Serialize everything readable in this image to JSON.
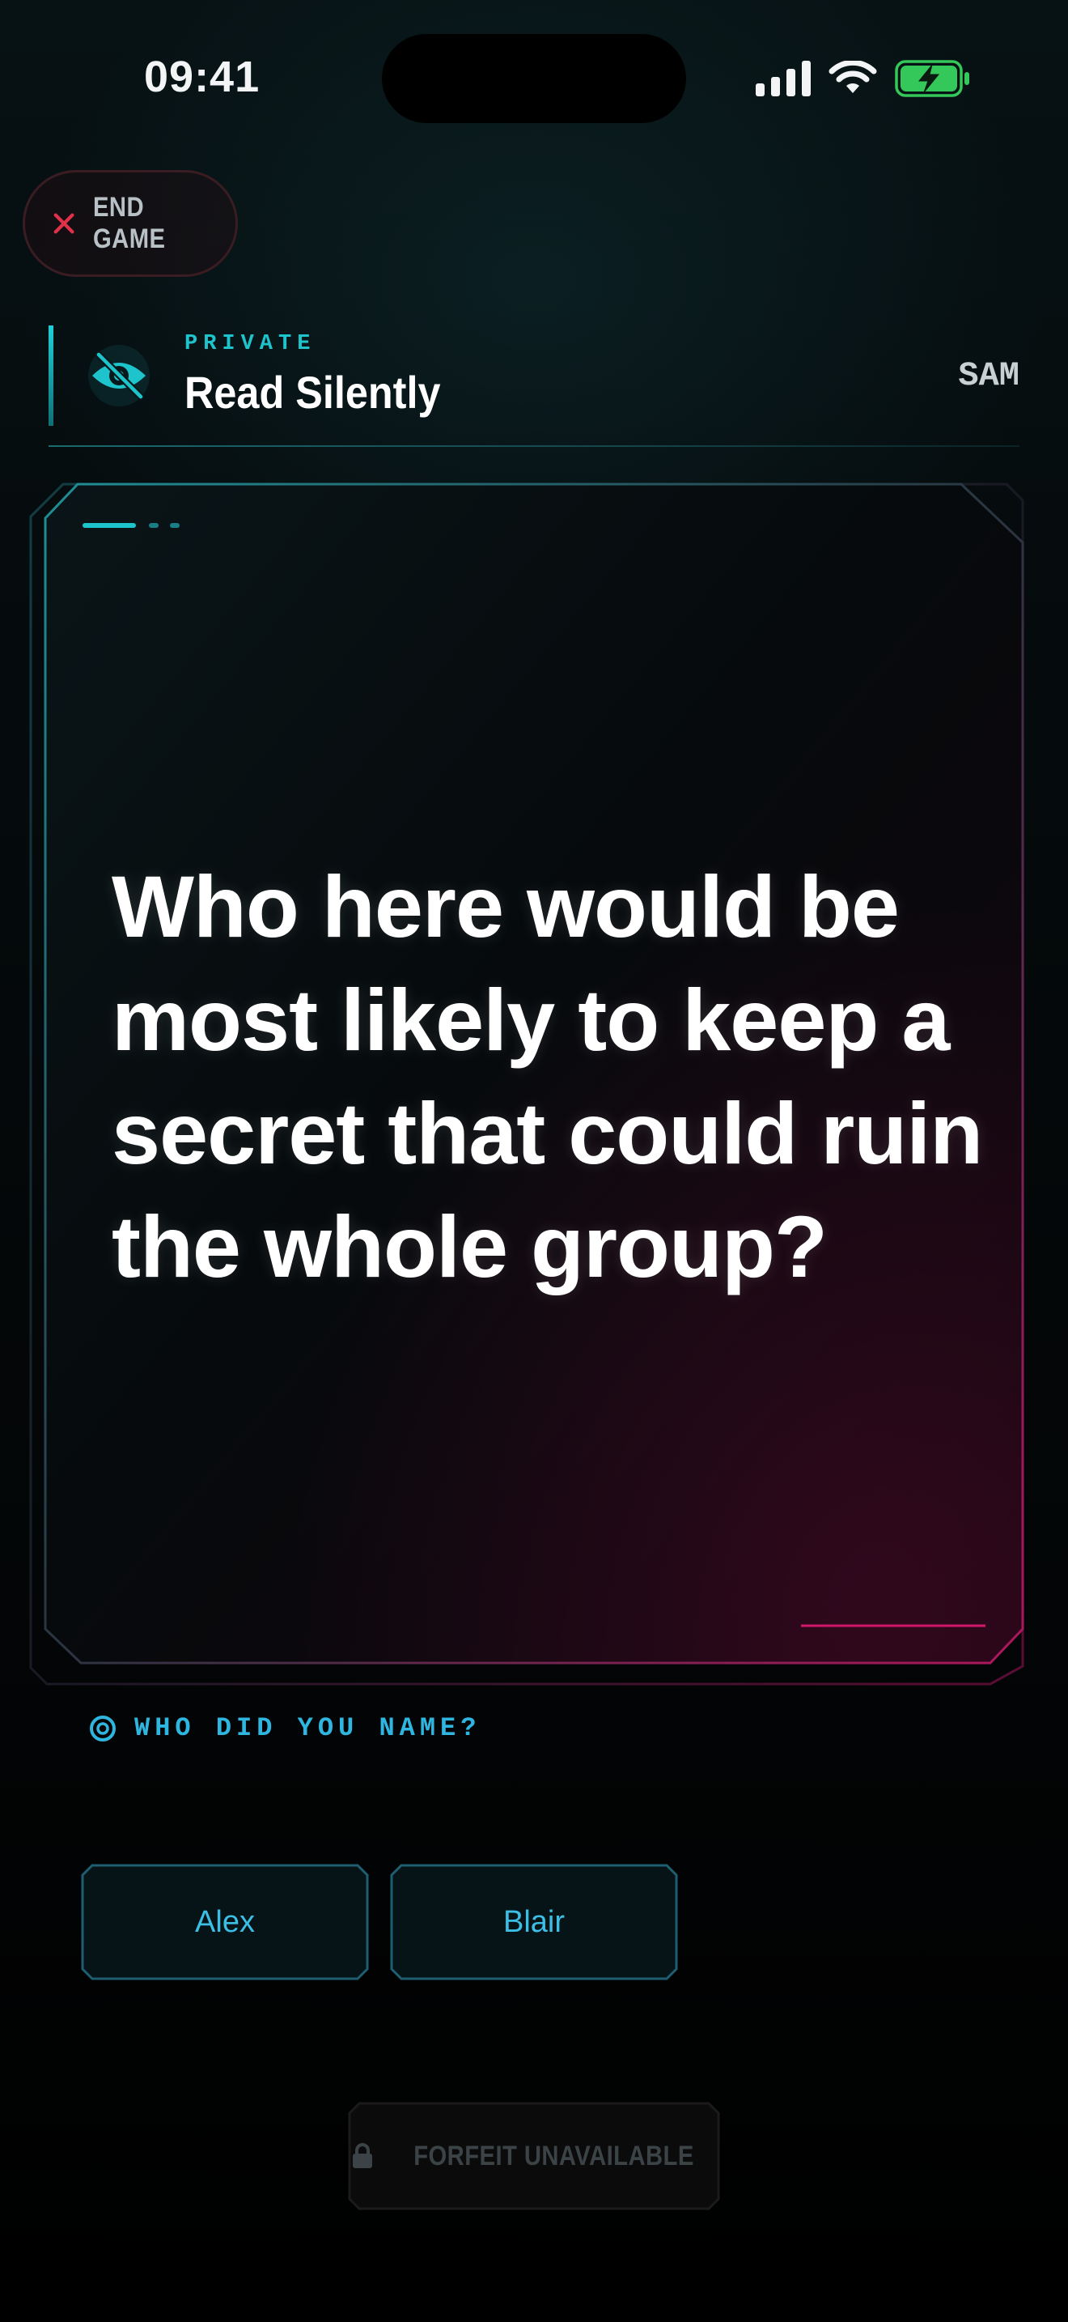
{
  "status_bar": {
    "time": "09:41"
  },
  "top": {
    "end_game_label": "END GAME"
  },
  "header": {
    "kicker": "PRIVATE",
    "title": "Read Silently",
    "player": "SAM"
  },
  "card": {
    "question": "Who here would be most likely to keep a secret that could ruin the whole group?"
  },
  "answer": {
    "prompt": "WHO DID YOU NAME?",
    "choices": [
      "Alex",
      "Blair"
    ]
  },
  "footer": {
    "forfeit_label": "FORFEIT UNAVAILABLE"
  },
  "colors": {
    "accent_cyan": "#1ec4cc",
    "accent_pink": "#d0186a",
    "danger_red": "#e0304a",
    "battery_green": "#34c759"
  },
  "icons": {
    "end_game": "close-icon",
    "header": "eye-slash-icon",
    "prompt": "target-icon",
    "forfeit": "lock-icon"
  }
}
